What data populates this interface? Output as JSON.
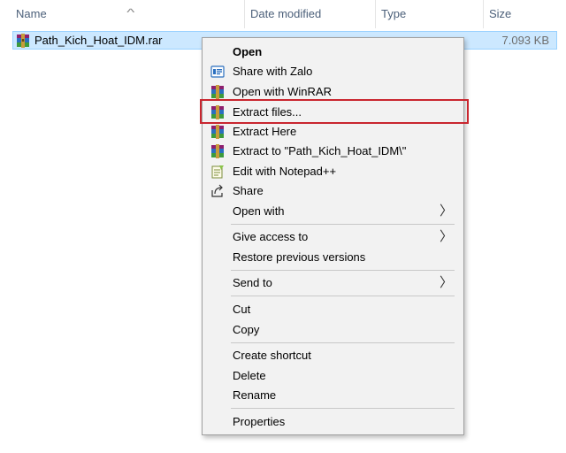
{
  "columns": {
    "name": "Name",
    "date_modified": "Date modified",
    "type": "Type",
    "size": "Size"
  },
  "file": {
    "name": "Path_Kich_Hoat_IDM.rar",
    "date_modified": "",
    "type": "",
    "size": "7.093 KB",
    "icon": "winrar-archive-icon"
  },
  "context_menu": {
    "items": [
      {
        "label": "Open",
        "icon": "",
        "bold": true
      },
      {
        "label": "Share with Zalo",
        "icon": "zalo-icon"
      },
      {
        "label": "Open with WinRAR",
        "icon": "winrar-icon"
      },
      {
        "label": "Extract files...",
        "icon": "winrar-icon"
      },
      {
        "label": "Extract Here",
        "icon": "winrar-icon"
      },
      {
        "label": "Extract to \"Path_Kich_Hoat_IDM\\\"",
        "icon": "winrar-icon"
      },
      {
        "label": "Edit with Notepad++",
        "icon": "notepad-plus-plus-icon"
      },
      {
        "label": "Share",
        "icon": "share-icon"
      },
      {
        "label": "Open with",
        "icon": "",
        "submenu_arrow": "〉"
      },
      {
        "label": "Give access to",
        "icon": "",
        "submenu_arrow": "〉"
      },
      {
        "label": "Restore previous versions",
        "icon": ""
      },
      {
        "label": "Send to",
        "icon": "",
        "submenu_arrow": "〉"
      },
      {
        "label": "Cut",
        "icon": ""
      },
      {
        "label": "Copy",
        "icon": ""
      },
      {
        "label": "Create shortcut",
        "icon": ""
      },
      {
        "label": "Delete",
        "icon": ""
      },
      {
        "label": "Rename",
        "icon": ""
      },
      {
        "label": "Properties",
        "icon": ""
      }
    ]
  },
  "highlight": {
    "target": "Extract files...",
    "color": "#c9262f"
  },
  "colors": {
    "selection_bg": "#cce8ff",
    "selection_border": "#99d1ff",
    "menu_bg": "#f2f2f2"
  }
}
